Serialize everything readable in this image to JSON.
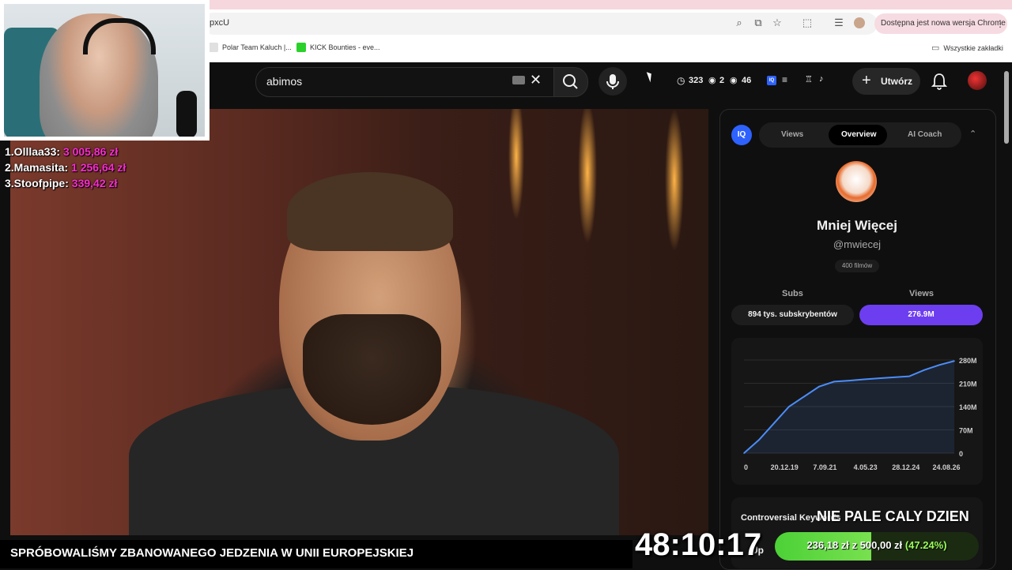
{
  "browser": {
    "url_fragment": "pxcU",
    "update_notice": "Dostępna jest nowa wersja Chrome",
    "bookmarks": [
      "Polar Team Kaluch |...",
      "KICK Bounties - eve..."
    ],
    "all_bookmarks": "Wszystkie zakładki"
  },
  "header": {
    "search_query": "abimos",
    "stats": {
      "watch": "323",
      "eye_a": "2",
      "eye_b": "46"
    },
    "create_label": "Utwórz",
    "iq_badge": "IQ"
  },
  "leaderboard": [
    {
      "rank_name": "1.Olllaa33:",
      "amount": "3 005,86 zł"
    },
    {
      "rank_name": "2.Mamasita:",
      "amount": "1 256,64 zł"
    },
    {
      "rank_name": "3.Stoofpipe:",
      "amount": "339,42 zł"
    }
  ],
  "panel": {
    "tabs": [
      "Views",
      "Overview",
      "AI Coach"
    ],
    "active_tab": "Overview",
    "channel_name": "Mniej Więcej",
    "channel_handle": "@mwiecej",
    "video_count": "400 filmów",
    "col_subs": "Subs",
    "col_views": "Views",
    "subs_value": "894 tys. subskrybentów",
    "views_value": "276.9M",
    "controversial_label": "Controversial Keywords"
  },
  "chart_data": {
    "type": "area",
    "x": [
      "0",
      "20.12.19",
      "7.09.21",
      "4.05.23",
      "28.12.24",
      "24.08.26"
    ],
    "y_ticks": [
      "280M",
      "210M",
      "140M",
      "70M",
      "0"
    ],
    "ylim": [
      0,
      280
    ],
    "series": [
      {
        "values": [
          0,
          40,
          90,
          140,
          170,
          200,
          215,
          218,
          222,
          225,
          228,
          231,
          250,
          265,
          277
        ]
      }
    ],
    "line_color": "#4b8df8",
    "grid": true
  },
  "stream": {
    "title": "SPRÓBOWALIŚMY ZBANOWANEGO JEDZENIA W UNII EUROPEJSKIEJ",
    "timer": "48:10:17",
    "goal_current": "236,18 zł",
    "goal_sep": "z",
    "goal_total": "500,00 zł",
    "goal_percent": "(47.24%)",
    "goal_fraction": 0.4724,
    "overlay_message": "NIE PALE CALY DZIEN",
    "up_fragment": "Up"
  },
  "colors": {
    "accent": "#6d3ef0",
    "iq_blue": "#2e62ff",
    "goal_green": "#4cd137",
    "donor_pink": "#ff2bd0"
  }
}
